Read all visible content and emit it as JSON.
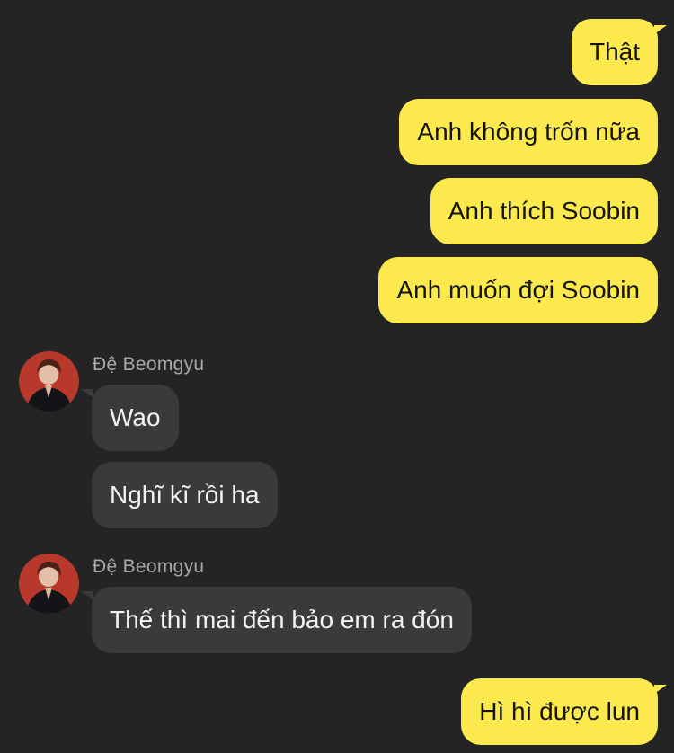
{
  "conversation": {
    "outgoing_group_1": [
      "Thật",
      "Anh không trốn nữa",
      "Anh thích Soobin",
      "Anh muốn đợi Soobin"
    ],
    "incoming_group_1": {
      "sender": "Đệ Beomgyu",
      "messages": [
        "Wao",
        "Nghĩ kĩ rồi ha"
      ]
    },
    "incoming_group_2": {
      "sender": "Đệ Beomgyu",
      "messages": [
        "Thế thì mai đến bảo em ra đón"
      ]
    },
    "outgoing_group_2": [
      "Hì hì được lun"
    ]
  },
  "colors": {
    "background": "#242424",
    "outgoing_bubble": "#fbe94e",
    "incoming_bubble": "#3a3a3c",
    "sender_name": "#a8a8a8"
  },
  "icons": {
    "avatar": "user-avatar-photo"
  }
}
